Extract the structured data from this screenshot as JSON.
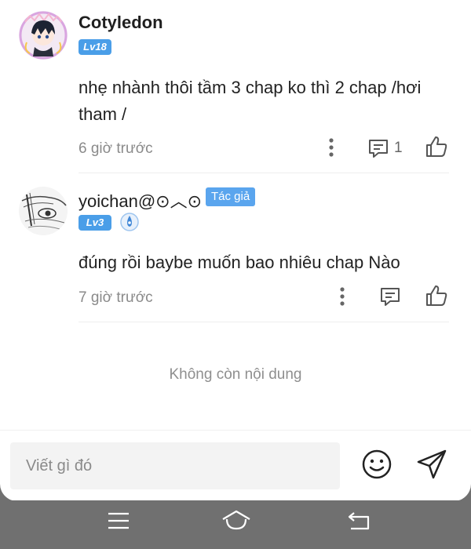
{
  "comments": [
    {
      "username": "Cotyledon",
      "level": "Lv18",
      "text": "nhẹ nhành thôi  tầm 3 chap ko thì 2 chap /hơi tham /",
      "time": "6 giờ trước",
      "reply_count": "1"
    },
    {
      "username": "yoichan@⊙︿⊙",
      "author_tag": "Tác giả",
      "level": "Lv3",
      "text": "đúng rồi baybe muốn bao nhiêu chap Nào",
      "time": "7 giờ trước"
    }
  ],
  "end_message": "Không còn nội dung",
  "composer": {
    "placeholder": "Viết gì đó"
  },
  "colors": {
    "accent": "#4a9ee8",
    "author_tag": "#5aa5ee",
    "nav_bar": "#707070"
  },
  "icons": [
    "more-vertical-icon",
    "comment-icon",
    "thumbs-up-icon",
    "verified-badge-icon",
    "emoji-icon",
    "send-icon",
    "menu-icon",
    "home-icon",
    "back-icon"
  ]
}
